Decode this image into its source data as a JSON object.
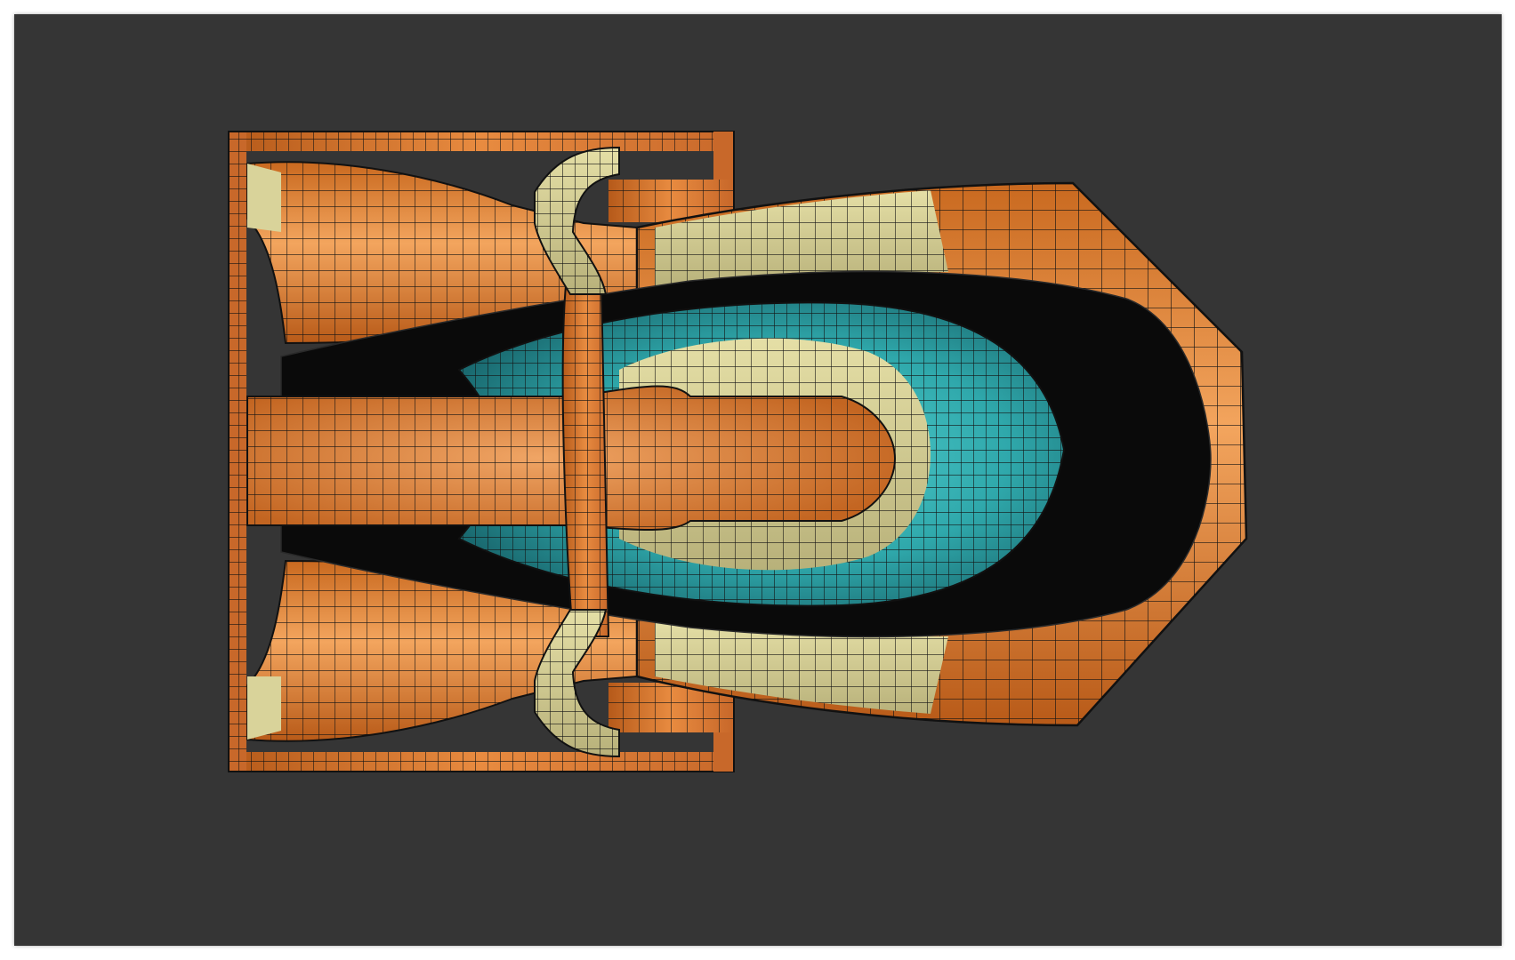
{
  "viewport": {
    "background_color": "#353535",
    "frame_color": "#ffffff",
    "display_mode": "shaded-with-mesh-edges"
  },
  "model": {
    "colors": {
      "orange": "#d9782f",
      "orange_highlight": "#f0a05a",
      "orange_shadow": "#8a4414",
      "cream": "#d9d39a",
      "cream_shadow": "#9e9860",
      "teal": "#36b5b5",
      "teal_shadow": "#1c6f74",
      "black": "#0a0a0a",
      "mesh_line": "#141414"
    }
  }
}
